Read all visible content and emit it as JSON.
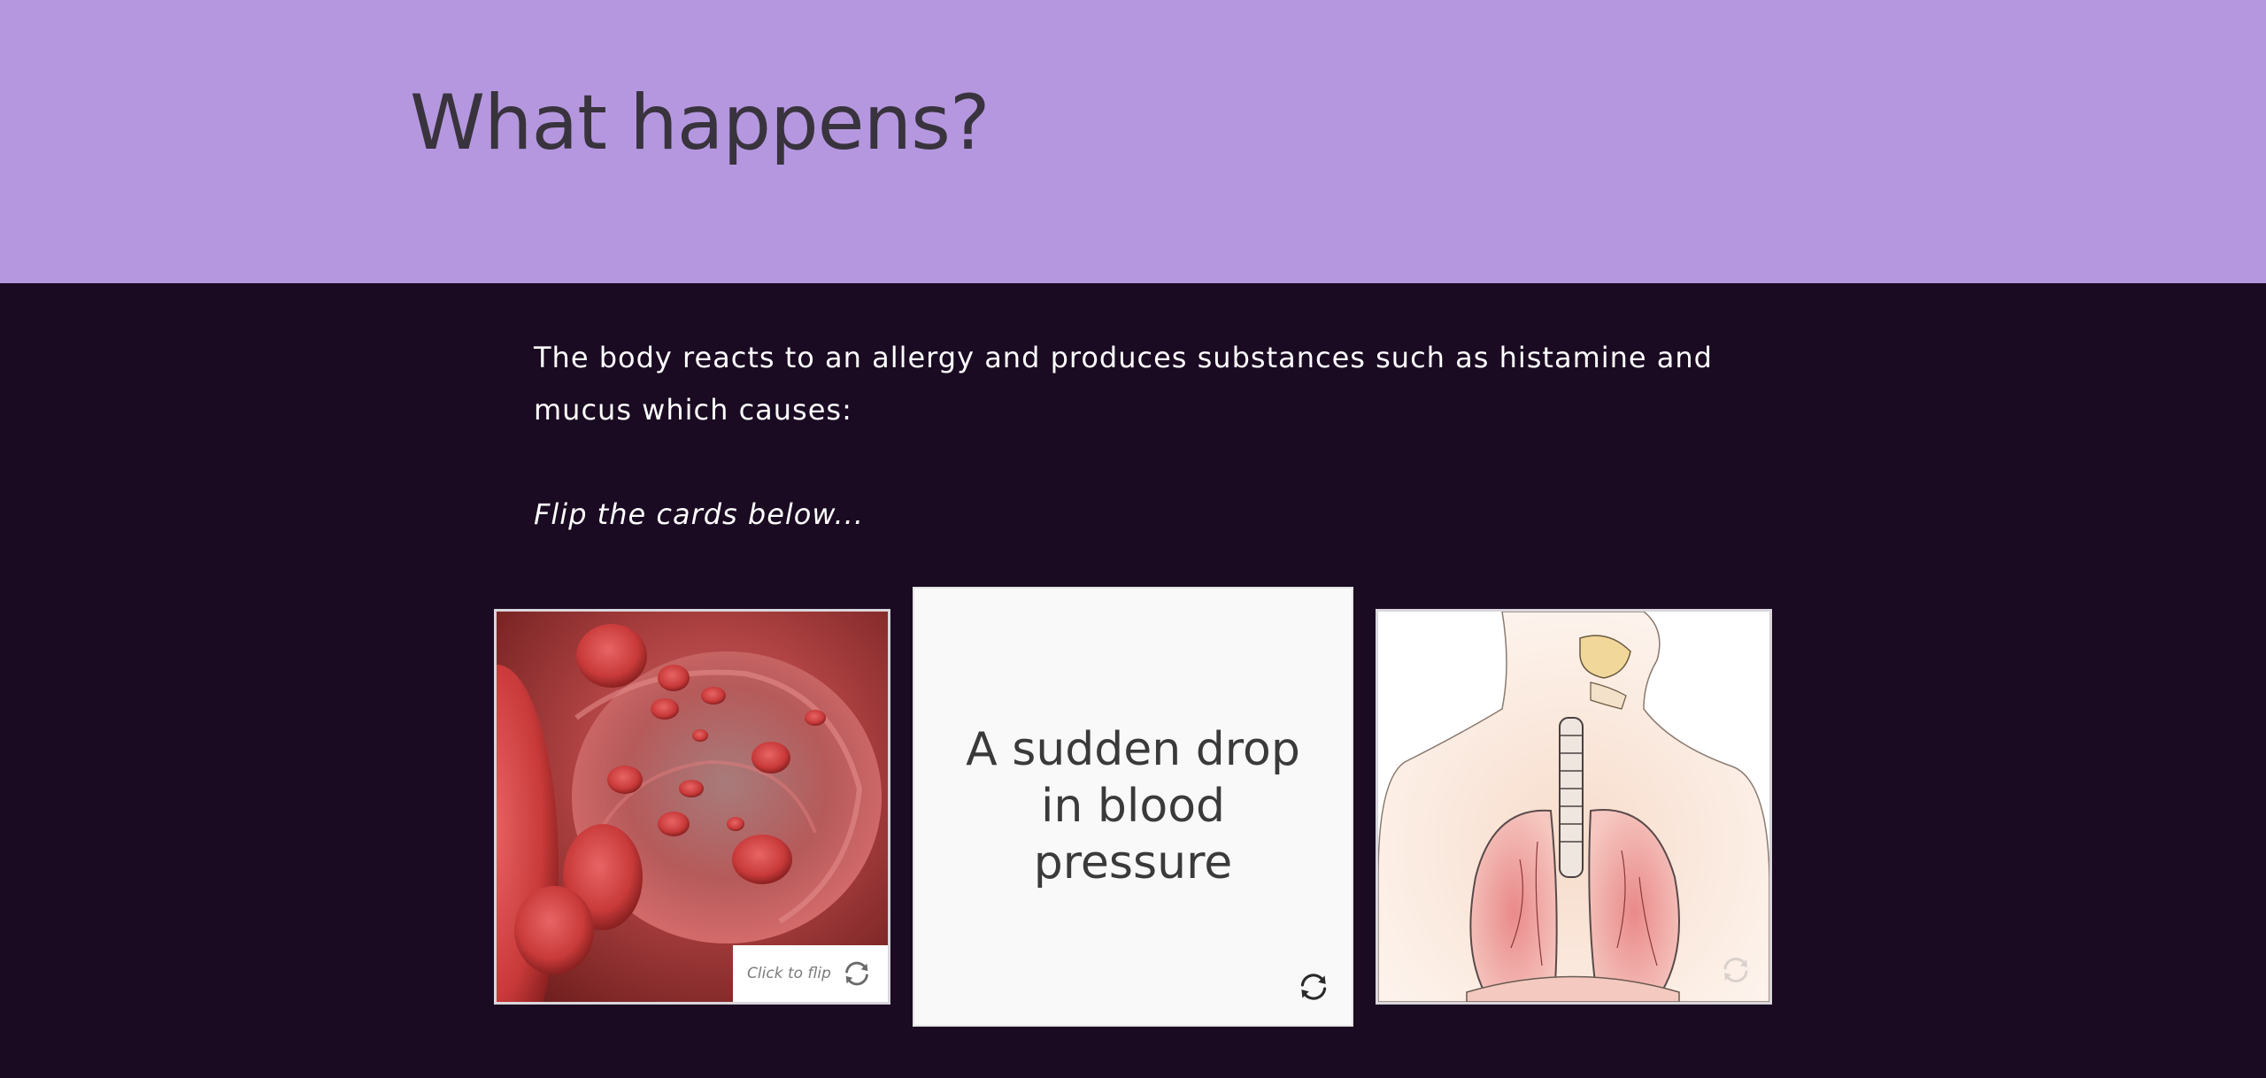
{
  "header": {
    "title": "What happens?",
    "background_color": "#b597df"
  },
  "content": {
    "intro_text": "The body reacts to an allergy and produces substances such as histamine and mucus which causes:",
    "instruction_text": "Flip the cards below..."
  },
  "cards": [
    {
      "image": "blood-cells-image",
      "flip_label": "Click to flip",
      "icon": "flip-icon"
    },
    {
      "text": "A sudden drop in blood pressure",
      "icon": "flip-icon"
    },
    {
      "image": "lungs-respiratory-system-image",
      "icon": "flip-icon"
    }
  ],
  "colors": {
    "page_background": "#1a0a22",
    "title_text": "#38333d",
    "body_text": "#ffffff"
  }
}
